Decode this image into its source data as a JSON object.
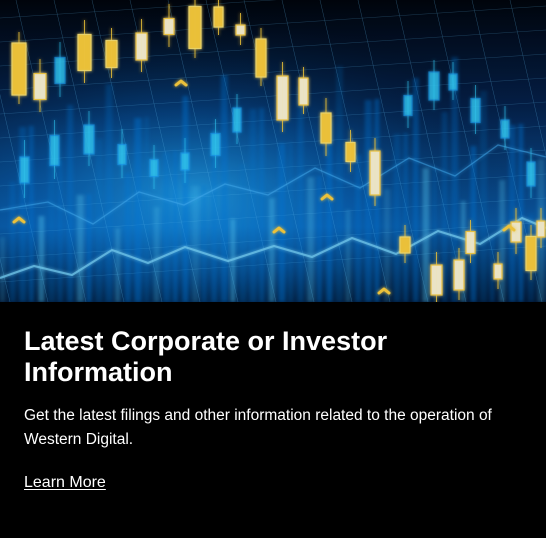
{
  "card": {
    "hero_image": "financial-candlestick-chart-image",
    "title": "Latest Corporate or Investor Information",
    "description": "Get the latest filings and other information related to the operation of Western Digital.",
    "link_label": "Learn More"
  },
  "colors": {
    "background": "#000000",
    "text": "#ffffff",
    "chart_blue": "#1ea7ff",
    "chart_cyan": "#33d1ff",
    "chart_yellow": "#ffd23f"
  }
}
